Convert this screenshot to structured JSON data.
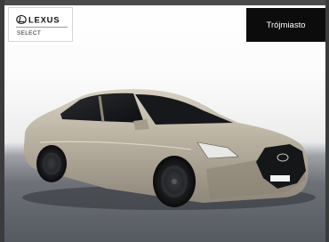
{
  "brand_badge": {
    "logo_icon": "lexus-logo-icon",
    "logo_text": "LEXUS",
    "program_label": "SELECT"
  },
  "location_badge": {
    "label": "Trójmiasto"
  },
  "photo": {
    "subject_icon": "car-image"
  },
  "colors": {
    "badge_dark": "#0c0c0c",
    "badge_light": "#ffffff",
    "car_body": "#b8b09f"
  }
}
